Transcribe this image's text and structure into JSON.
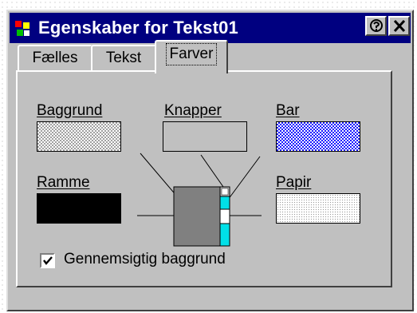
{
  "window": {
    "title": "Egenskaber for Tekst01",
    "help_button": "help-button",
    "close_button": "close-button"
  },
  "tabs": [
    {
      "label": "Fælles",
      "active": false
    },
    {
      "label": "Tekst",
      "active": false
    },
    {
      "label": "Farver",
      "active": true
    }
  ],
  "colors_panel": {
    "baggrund_label": "Baggrund",
    "knapper_label": "Knapper",
    "bar_label": "Bar",
    "ramme_label": "Ramme",
    "papir_label": "Papir",
    "colors": {
      "baggrund": "#c0c0c0 dither",
      "knapper": "#c0c0c0",
      "bar": "#1a1aff dither",
      "ramme": "#000000",
      "papir": "#ffffff dotted"
    }
  },
  "transparent_background": {
    "label": "Gennemsigtig baggrund",
    "checked": true
  },
  "icons": {
    "app": "colorful-puzzle-icon",
    "help": "help-question-icon",
    "close": "close-x-icon",
    "check": "check-mark-icon"
  }
}
